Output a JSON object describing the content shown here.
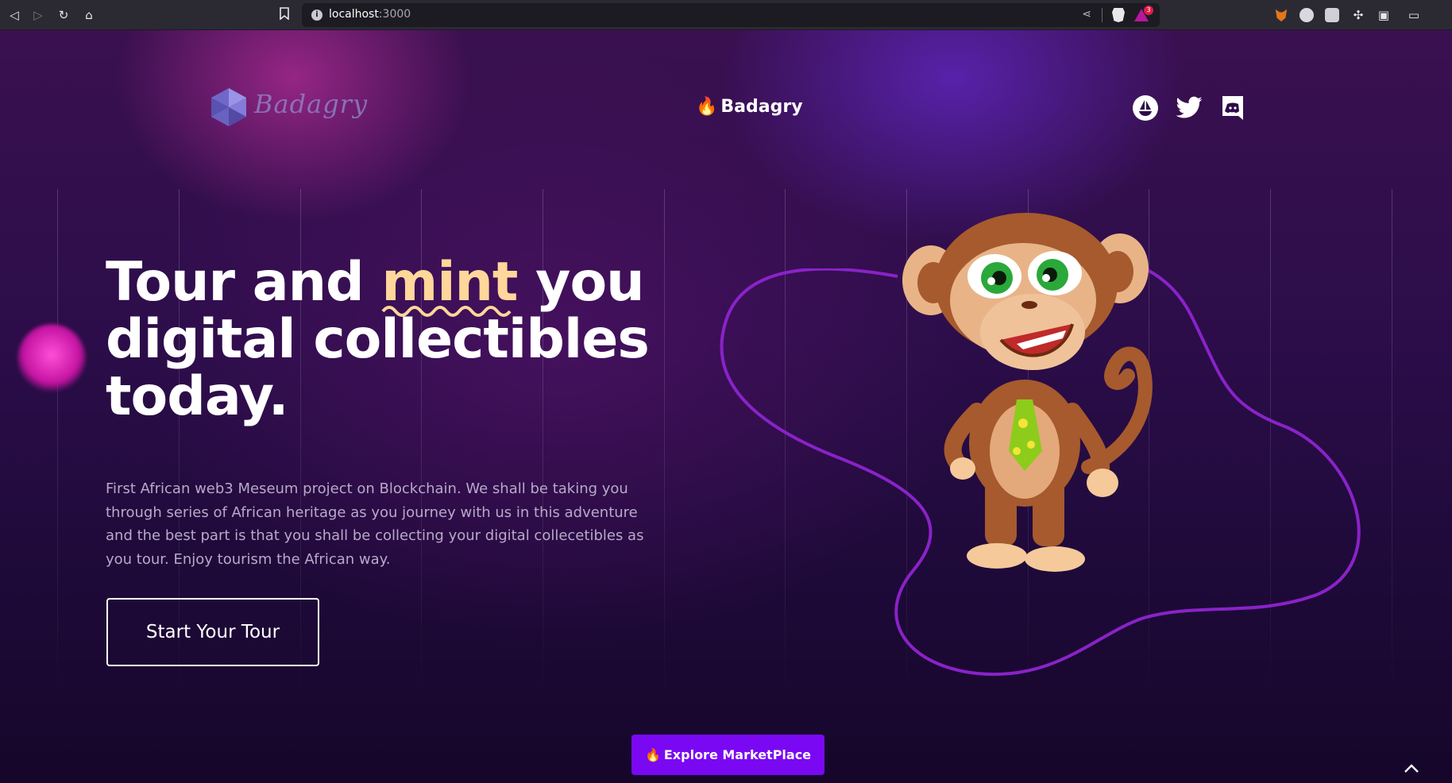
{
  "browser": {
    "url_host": "localhost",
    "url_port": ":3000",
    "rewards_badge": "3",
    "icons": [
      "back-icon",
      "forward-icon",
      "reload-icon",
      "home-icon",
      "bookmark-icon",
      "share-icon",
      "brave-shield-icon",
      "brave-rewards-icon",
      "metamask-icon",
      "extension-icon",
      "extension-icon",
      "puzzle-icon",
      "sidebar-icon",
      "wallet-icon"
    ]
  },
  "header": {
    "logo_text": "Badagry",
    "brand_text": "Badagry",
    "social": [
      {
        "name": "opensea",
        "icon": "opensea-icon"
      },
      {
        "name": "twitter",
        "icon": "twitter-icon"
      },
      {
        "name": "discord",
        "icon": "discord-icon"
      }
    ]
  },
  "hero": {
    "title_part1": "Tour and ",
    "title_highlight": "mint",
    "title_part2": " you",
    "title_line2": "digital collectibles",
    "title_line3": "today.",
    "description": "First African web3 Meseum project on Blockchain. We shall be taking you through series of African heritage as you journey with us in this adventure and the best part is that you shall be collecting your digital collecetibles as you tour. Enjoy tourism the African way.",
    "cta_label": "Start Your Tour"
  },
  "explore_label": "Explore MarketPlace",
  "colors": {
    "accent": "#7a08f2",
    "highlight": "#ffd79a",
    "curve": "#8a22c8",
    "browser_bg": "#2b2a33"
  }
}
